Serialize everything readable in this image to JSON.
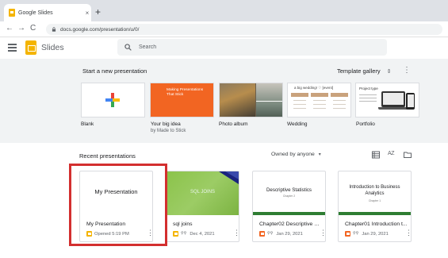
{
  "browser": {
    "tab_title": "Google Slides",
    "tab_close": "×",
    "new_tab": "+",
    "url": "docs.google.com/presentation/u/0/",
    "back": "←",
    "forward": "→",
    "reload": "C"
  },
  "app": {
    "name": "Slides",
    "search_placeholder": "Search"
  },
  "templates": {
    "title": "Start a new presentation",
    "gallery_label": "Template gallery",
    "gallery_arrows": "⇕",
    "more": "⋮",
    "items": [
      {
        "label": "Blank",
        "sub": ""
      },
      {
        "label": "Your big idea",
        "sub": "by Made to Stick",
        "thumb_text": "Making Presentations That Stick"
      },
      {
        "label": "Photo album",
        "sub": ""
      },
      {
        "label": "Wedding",
        "sub": "",
        "thumb_text": "a big wedding! ♡ [event]"
      },
      {
        "label": "Portfolio",
        "sub": "",
        "thumb_text": "Project type"
      }
    ]
  },
  "recent": {
    "title": "Recent presentations",
    "owned_by": "Owned by anyone",
    "owned_caret": "▾",
    "az_label": "A Z",
    "files": [
      {
        "thumb_title": "My Presentation",
        "name": "My Presentation",
        "meta": "Opened 5:19 PM",
        "icon_color": "#f4b400",
        "kebab": "⋮"
      },
      {
        "thumb_title": "SQL JOINS",
        "name": "sql joins",
        "meta": "Dec 4, 2021",
        "shared": "⚲⚲",
        "icon_color": "#f4b400",
        "kebab": "⋮"
      },
      {
        "thumb_title": "Descriptive Statistics",
        "thumb_sub": "Chapter 2",
        "name": "Chapter02 Descriptive St...",
        "meta": "Jan 29, 2021",
        "shared": "⚲⚲",
        "icon_color": "#f26522",
        "kebab": "⋮"
      },
      {
        "thumb_title": "Introduction to Business Analytics",
        "thumb_sub": "Chapter 1",
        "name": "Chapter01 Introduction t...",
        "meta": "Jan 29, 2021",
        "shared": "⚲⚲",
        "icon_color": "#f26522",
        "kebab": "⋮"
      }
    ]
  },
  "colors": {
    "accent_yellow": "#f4b400",
    "highlight_red": "#d32f2f",
    "idea_orange": "#f26522",
    "chapter_green": "#2e7d32"
  }
}
